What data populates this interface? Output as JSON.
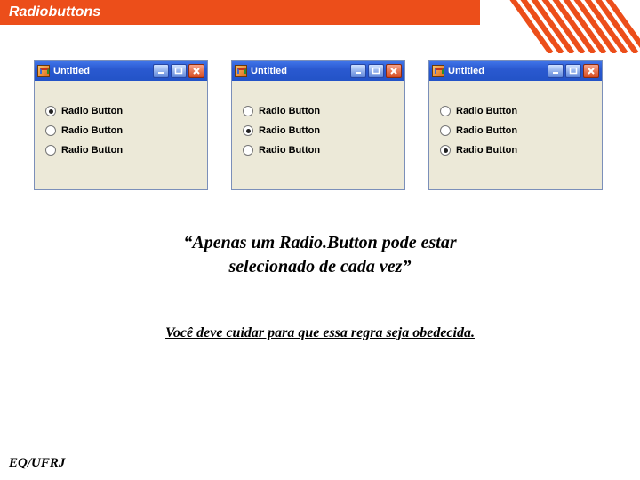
{
  "header": {
    "title": "Radiobuttons"
  },
  "windows": [
    {
      "title": "Untitled",
      "radios": [
        {
          "label": "Radio Button",
          "selected": true
        },
        {
          "label": "Radio Button",
          "selected": false
        },
        {
          "label": "Radio Button",
          "selected": false
        }
      ]
    },
    {
      "title": "Untitled",
      "radios": [
        {
          "label": "Radio Button",
          "selected": false
        },
        {
          "label": "Radio Button",
          "selected": true
        },
        {
          "label": "Radio Button",
          "selected": false
        }
      ]
    },
    {
      "title": "Untitled",
      "radios": [
        {
          "label": "Radio Button",
          "selected": false
        },
        {
          "label": "Radio Button",
          "selected": false
        },
        {
          "label": "Radio Button",
          "selected": true
        }
      ]
    }
  ],
  "quote": {
    "line1": "“Apenas um Radio.Button pode estar",
    "line2": "selecionado de cada vez”"
  },
  "rule": "Você deve cuidar para que essa regra seja obedecida.",
  "footer": "EQ/UFRJ",
  "colors": {
    "accent": "#ec4e1a"
  }
}
